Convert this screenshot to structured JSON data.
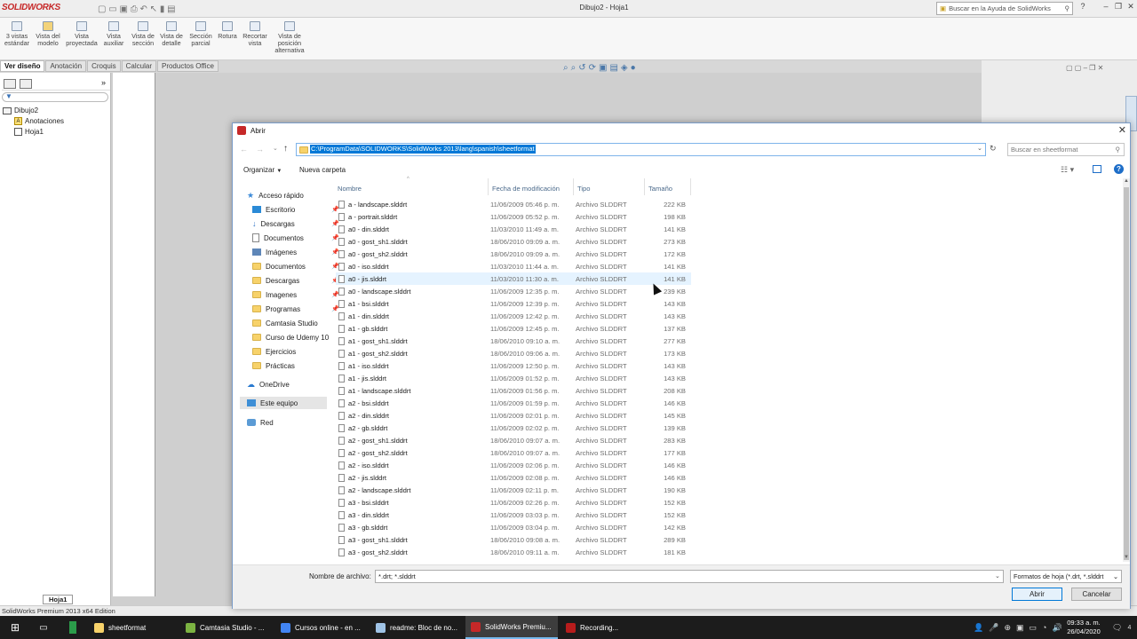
{
  "app": {
    "logo": "SOLIDWORKS",
    "window_title": "Dibujo2 - Hoja1",
    "help_search_placeholder": "Buscar en la Ayuda de SolidWorks",
    "status_text": "SolidWorks Premium 2013 x64 Edition"
  },
  "ribbon": {
    "buttons": [
      {
        "label": "3 vistas estándar"
      },
      {
        "label": "Vista del modelo"
      },
      {
        "label": "Vista proyectada"
      },
      {
        "label": "Vista auxiliar"
      },
      {
        "label": "Vista de sección"
      },
      {
        "label": "Vista de detalle"
      },
      {
        "label": "Sección parcial"
      },
      {
        "label": "Rotura"
      },
      {
        "label": "Recortar vista"
      },
      {
        "label": "Vista de posición alternativa"
      }
    ]
  },
  "command_tabs": [
    "Ver diseño",
    "Anotación",
    "Croquis",
    "Calcular",
    "Productos Office"
  ],
  "feature_tree": {
    "root": "Dibujo2",
    "items": [
      "Anotaciones",
      "Hoja1"
    ]
  },
  "sheet_tab": "Hoja1",
  "dialog": {
    "title": "Abrir",
    "path": "C:\\ProgramData\\SOLIDWORKS\\SolidWorks 2013\\lang\\spanish\\sheetformat",
    "search_placeholder": "Buscar en sheetformat",
    "organize_label": "Organizar",
    "new_folder_label": "Nueva carpeta",
    "nav": {
      "quick_access": "Acceso rápido",
      "items": [
        {
          "label": "Escritorio",
          "pinned": true
        },
        {
          "label": "Descargas",
          "pinned": true
        },
        {
          "label": "Documentos",
          "pinned": true
        },
        {
          "label": "Imágenes",
          "pinned": true
        },
        {
          "label": "Documentos",
          "pinned": true
        },
        {
          "label": "Descargas",
          "pinned": true
        },
        {
          "label": "Imagenes",
          "pinned": true
        },
        {
          "label": "Programas",
          "pinned": true
        },
        {
          "label": "Camtasia Studio",
          "pinned": false
        },
        {
          "label": "Curso de Udemy 10",
          "pinned": false
        },
        {
          "label": "Ejercicios",
          "pinned": false
        },
        {
          "label": "Prácticas",
          "pinned": false
        }
      ],
      "onedrive": "OneDrive",
      "this_pc": "Este equipo",
      "network": "Red"
    },
    "columns": {
      "name": "Nombre",
      "modified": "Fecha de modificación",
      "type": "Tipo",
      "size": "Tamaño"
    },
    "files": [
      {
        "name": "a - landscape.slddrt",
        "modified": "11/06/2009 05:46 p. m.",
        "type": "Archivo SLDDRT",
        "size": "222 KB"
      },
      {
        "name": "a - portrait.slddrt",
        "modified": "11/06/2009 05:52 p. m.",
        "type": "Archivo SLDDRT",
        "size": "198 KB"
      },
      {
        "name": "a0 - din.slddrt",
        "modified": "11/03/2010 11:49 a. m.",
        "type": "Archivo SLDDRT",
        "size": "141 KB"
      },
      {
        "name": "a0 - gost_sh1.slddrt",
        "modified": "18/06/2010 09:09 a. m.",
        "type": "Archivo SLDDRT",
        "size": "273 KB"
      },
      {
        "name": "a0 - gost_sh2.slddrt",
        "modified": "18/06/2010 09:09 a. m.",
        "type": "Archivo SLDDRT",
        "size": "172 KB"
      },
      {
        "name": "a0 - iso.slddrt",
        "modified": "11/03/2010 11:44 a. m.",
        "type": "Archivo SLDDRT",
        "size": "141 KB"
      },
      {
        "name": "a0 - jis.slddrt",
        "modified": "11/03/2010 11:30 a. m.",
        "type": "Archivo SLDDRT",
        "size": "141 KB"
      },
      {
        "name": "a0 - landscape.slddrt",
        "modified": "11/06/2009 12:35 p. m.",
        "type": "Archivo SLDDRT",
        "size": "239 KB"
      },
      {
        "name": "a1 - bsi.slddrt",
        "modified": "11/06/2009 12:39 p. m.",
        "type": "Archivo SLDDRT",
        "size": "143 KB"
      },
      {
        "name": "a1 - din.slddrt",
        "modified": "11/06/2009 12:42 p. m.",
        "type": "Archivo SLDDRT",
        "size": "143 KB"
      },
      {
        "name": "a1 - gb.slddrt",
        "modified": "11/06/2009 12:45 p. m.",
        "type": "Archivo SLDDRT",
        "size": "137 KB"
      },
      {
        "name": "a1 - gost_sh1.slddrt",
        "modified": "18/06/2010 09:10 a. m.",
        "type": "Archivo SLDDRT",
        "size": "277 KB"
      },
      {
        "name": "a1 - gost_sh2.slddrt",
        "modified": "18/06/2010 09:06 a. m.",
        "type": "Archivo SLDDRT",
        "size": "173 KB"
      },
      {
        "name": "a1 - iso.slddrt",
        "modified": "11/06/2009 12:50 p. m.",
        "type": "Archivo SLDDRT",
        "size": "143 KB"
      },
      {
        "name": "a1 - jis.slddrt",
        "modified": "11/06/2009 01:52 p. m.",
        "type": "Archivo SLDDRT",
        "size": "143 KB"
      },
      {
        "name": "a1 - landscape.slddrt",
        "modified": "11/06/2009 01:56 p. m.",
        "type": "Archivo SLDDRT",
        "size": "208 KB"
      },
      {
        "name": "a2 - bsi.slddrt",
        "modified": "11/06/2009 01:59 p. m.",
        "type": "Archivo SLDDRT",
        "size": "146 KB"
      },
      {
        "name": "a2 - din.slddrt",
        "modified": "11/06/2009 02:01 p. m.",
        "type": "Archivo SLDDRT",
        "size": "145 KB"
      },
      {
        "name": "a2 - gb.slddrt",
        "modified": "11/06/2009 02:02 p. m.",
        "type": "Archivo SLDDRT",
        "size": "139 KB"
      },
      {
        "name": "a2 - gost_sh1.slddrt",
        "modified": "18/06/2010 09:07 a. m.",
        "type": "Archivo SLDDRT",
        "size": "283 KB"
      },
      {
        "name": "a2 - gost_sh2.slddrt",
        "modified": "18/06/2010 09:07 a. m.",
        "type": "Archivo SLDDRT",
        "size": "177 KB"
      },
      {
        "name": "a2 - iso.slddrt",
        "modified": "11/06/2009 02:06 p. m.",
        "type": "Archivo SLDDRT",
        "size": "146 KB"
      },
      {
        "name": "a2 - jis.slddrt",
        "modified": "11/06/2009 02:08 p. m.",
        "type": "Archivo SLDDRT",
        "size": "146 KB"
      },
      {
        "name": "a2 - landscape.slddrt",
        "modified": "11/06/2009 02:11 p. m.",
        "type": "Archivo SLDDRT",
        "size": "190 KB"
      },
      {
        "name": "a3 - bsi.slddrt",
        "modified": "11/06/2009 02:26 p. m.",
        "type": "Archivo SLDDRT",
        "size": "152 KB"
      },
      {
        "name": "a3 - din.slddrt",
        "modified": "11/06/2009 03:03 p. m.",
        "type": "Archivo SLDDRT",
        "size": "152 KB"
      },
      {
        "name": "a3 - gb.slddrt",
        "modified": "11/06/2009 03:04 p. m.",
        "type": "Archivo SLDDRT",
        "size": "142 KB"
      },
      {
        "name": "a3 - gost_sh1.slddrt",
        "modified": "18/06/2010 09:08 a. m.",
        "type": "Archivo SLDDRT",
        "size": "289 KB"
      },
      {
        "name": "a3 - gost_sh2.slddrt",
        "modified": "18/06/2010 09:11 a. m.",
        "type": "Archivo SLDDRT",
        "size": "181 KB"
      }
    ],
    "hovered_index": 6,
    "filename_label": "Nombre de archivo:",
    "filename_value": "*.drt; *.slddrt",
    "filetype_value": "Formatos de hoja (*.drt, *.slddrt",
    "open_label": "Abrir",
    "cancel_label": "Cancelar"
  },
  "taskbar": {
    "items": [
      {
        "label": "sheetformat",
        "icon": "folder-icon"
      },
      {
        "label": "Camtasia Studio - ...",
        "icon": "camtasia-icon"
      },
      {
        "label": "Cursos online - en ...",
        "icon": "chrome-icon"
      },
      {
        "label": "readme: Bloc de no...",
        "icon": "notepad-icon"
      },
      {
        "label": "SolidWorks Premiu...",
        "icon": "solidworks-icon"
      },
      {
        "label": "Recording...",
        "icon": "recording-icon"
      }
    ],
    "active_index": 4,
    "time": "09:33 a. m.",
    "date": "26/04/2020",
    "notification_count": "4"
  },
  "colors": {
    "accent": "#0078d7",
    "sw_red": "#c62828",
    "taskbar": "#1c1c1c",
    "folder": "#f7d26a"
  }
}
